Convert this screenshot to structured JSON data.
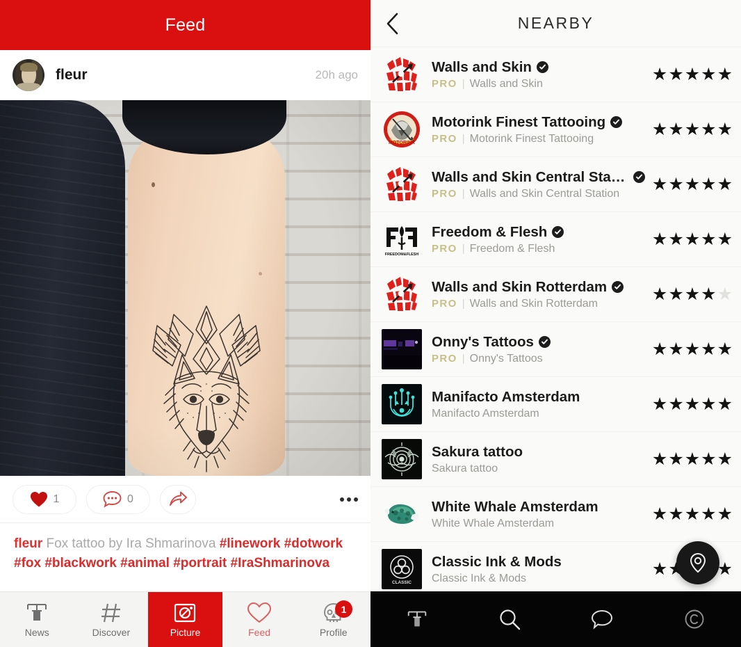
{
  "colors": {
    "brand_red": "#d9100f",
    "tag_red": "#dc2b2b",
    "pro_gold": "#c6bf87",
    "dark_nav": "#050505",
    "star_on": "#141414",
    "star_off": "#e2e1dd"
  },
  "left_panel": {
    "header": {
      "title": "Feed"
    },
    "post": {
      "username": "fleur",
      "timestamp": "20h ago",
      "avatar_icon": "user-avatar-photo",
      "image_alt": "fox-tattoo-photo",
      "actions": {
        "like_icon": "heart-icon",
        "like_count": "1",
        "comment_icon": "comment-bubble-icon",
        "comment_count": "0",
        "share_icon": "share-arrow-icon",
        "more_icon": "more-options-icon"
      },
      "caption": {
        "username": "fleur",
        "text": "Fox tattoo by Ira Shmarinova",
        "hashtags": [
          "#linework",
          "#dotwork",
          "#fox",
          "#blackwork",
          "#animal",
          "#portrait",
          "#IraShmarinova"
        ]
      }
    },
    "tabbar": [
      {
        "label": "News",
        "icon": "tattoo-machine-icon",
        "active": false,
        "badge": null
      },
      {
        "label": "Discover",
        "icon": "hashtag-icon",
        "active": false,
        "badge": null
      },
      {
        "label": "Picture",
        "icon": "camera-icon",
        "active": true,
        "badge": null
      },
      {
        "label": "Feed",
        "icon": "heart-outline-icon",
        "active": false,
        "badge": null
      },
      {
        "label": "Profile",
        "icon": "skull-icon",
        "active": false,
        "badge": "1"
      }
    ]
  },
  "right_panel": {
    "header": {
      "title": "NEARBY",
      "back_icon": "chevron-left-icon"
    },
    "pro_label": "PRO",
    "separator": "|",
    "shops": [
      {
        "name": "Walls and Skin",
        "handle": "Walls and Skin",
        "pro": true,
        "verified": true,
        "rating": 5,
        "thumb": "walls-and-skin-logo"
      },
      {
        "name": "Motorink Finest Tattooing",
        "handle": "Motorink Finest Tattooing",
        "pro": true,
        "verified": true,
        "rating": 5,
        "thumb": "motorink-logo"
      },
      {
        "name": "Walls and Skin Central Station",
        "handle": "Walls and Skin Central Station",
        "pro": true,
        "verified": true,
        "rating": 5,
        "thumb": "walls-and-skin-logo"
      },
      {
        "name": "Freedom & Flesh",
        "handle": "Freedom & Flesh",
        "pro": true,
        "verified": true,
        "rating": 5,
        "thumb": "freedom-and-flesh-logo"
      },
      {
        "name": "Walls and Skin Rotterdam",
        "handle": "Walls and Skin Rotterdam",
        "pro": true,
        "verified": true,
        "rating": 4,
        "thumb": "walls-and-skin-logo"
      },
      {
        "name": "Onny's Tattoos",
        "handle": "Onny's Tattoos",
        "pro": true,
        "verified": true,
        "rating": 5,
        "thumb": "onnys-tattoos-photo"
      },
      {
        "name": "Manifacto Amsterdam",
        "handle": "Manifacto Amsterdam",
        "pro": false,
        "verified": false,
        "rating": 5,
        "thumb": "manifacto-logo"
      },
      {
        "name": "Sakura tattoo",
        "handle": "Sakura tattoo",
        "pro": false,
        "verified": false,
        "rating": 5,
        "thumb": "sakura-tattoo-logo"
      },
      {
        "name": "White Whale Amsterdam",
        "handle": "White Whale Amsterdam",
        "pro": false,
        "verified": false,
        "rating": 5,
        "thumb": "white-whale-logo"
      },
      {
        "name": "Classic Ink & Mods",
        "handle": "Classic Ink & Mods",
        "pro": false,
        "verified": false,
        "rating": 5,
        "thumb": "classic-ink-logo"
      }
    ],
    "fab": {
      "icon": "location-pin-icon"
    },
    "tabbar": [
      {
        "icon": "tattoo-machine-icon"
      },
      {
        "icon": "search-icon"
      },
      {
        "icon": "chat-bubble-icon"
      },
      {
        "icon": "copyright-circle-icon"
      }
    ]
  }
}
